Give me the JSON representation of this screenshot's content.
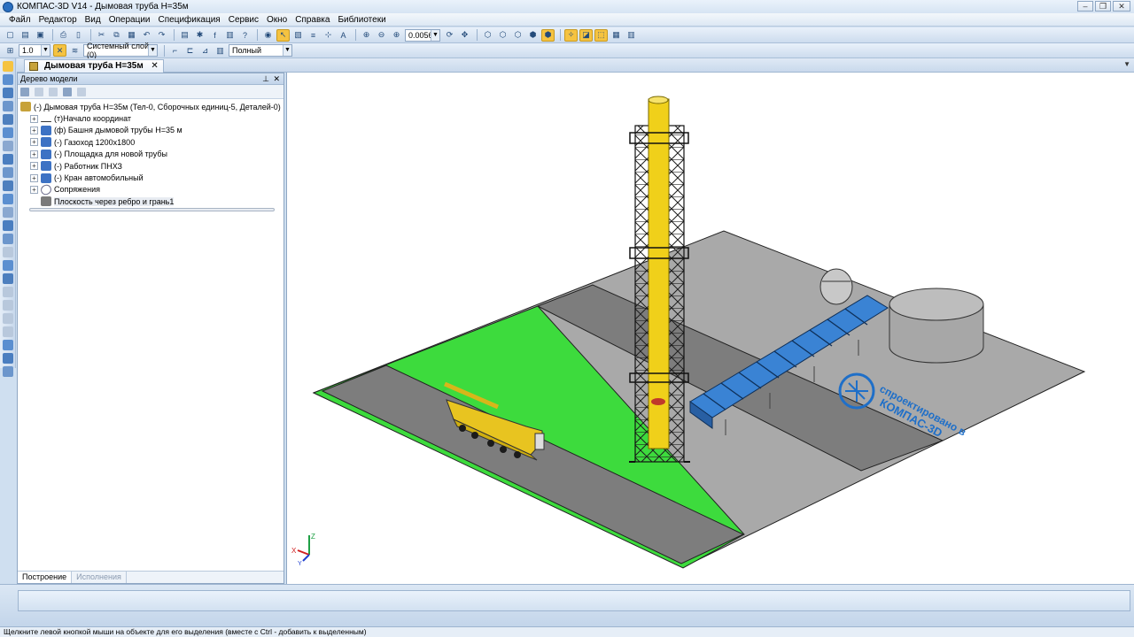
{
  "window": {
    "title": "КОМПАС-3D V14 - Дымовая труба Н=35м"
  },
  "menu": [
    "Файл",
    "Редактор",
    "Вид",
    "Операции",
    "Спецификация",
    "Сервис",
    "Окно",
    "Справка",
    "Библиотеки"
  ],
  "toolbar": {
    "zoom_value": "0.0056",
    "step_value": "1.0",
    "layer_value": "Системный слой (0)",
    "view_mode_value": "Полный"
  },
  "doc_tab": {
    "label": "Дымовая труба Н=35м"
  },
  "tree_panel": {
    "title": "Дерево модели",
    "root": "(-) Дымовая труба Н=35м (Тел-0, Сборочных единиц-5, Деталей-0)",
    "items": [
      "(т)Начало координат",
      "(ф) Башня дымовой трубы Н=35 м",
      "(-) Газоход 1200х1800",
      "(-) Площадка для новой трубы",
      "(-) Работник ПНХЗ",
      "(-) Кран автомобильный",
      "Сопряжения",
      "Плоскость через ребро и грань1"
    ],
    "tabs": [
      "Построение",
      "Исполнения"
    ]
  },
  "viewport": {
    "stamp_line1": "спроектировано в",
    "stamp_line2": "КОМПАС-3D",
    "axis_x": "X",
    "axis_y": "Y",
    "axis_z": "Z",
    "colors": {
      "grass": "#3ddb3d",
      "road": "#7d7d7d",
      "concrete": "#a9a9a9",
      "chimney": "#f0d01a",
      "duct": "#3a83d4"
    }
  },
  "status": {
    "text": "Щелкните левой кнопкой мыши на объекте для его выделения (вместе с Ctrl - добавить к выделенным)"
  }
}
